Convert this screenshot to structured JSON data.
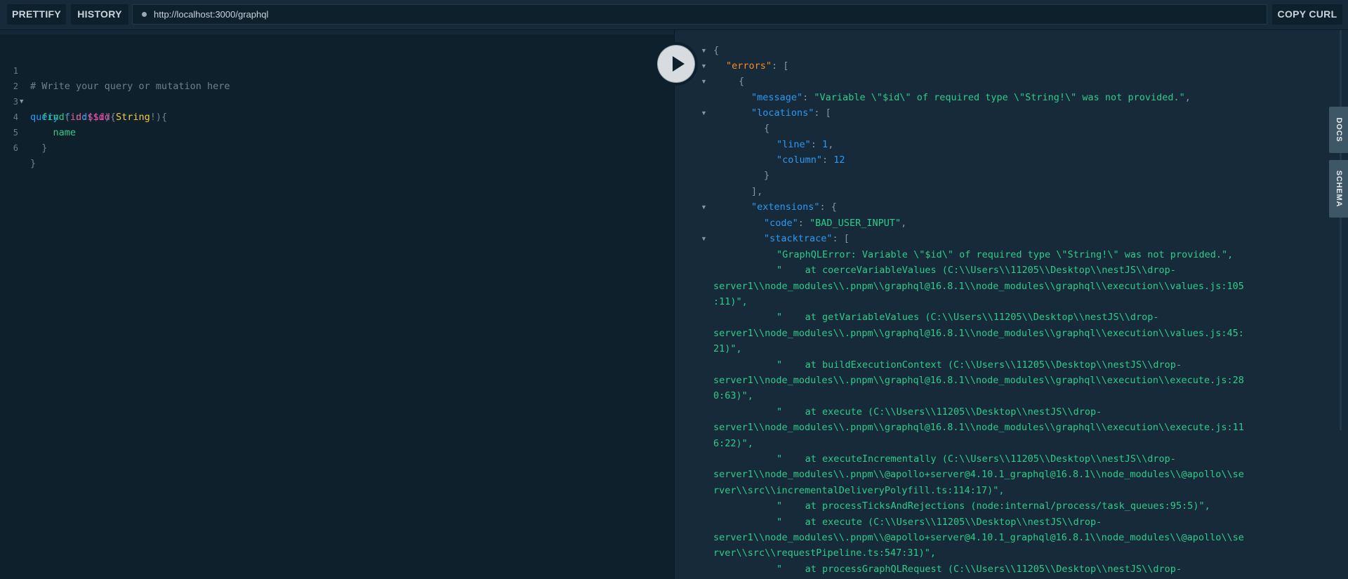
{
  "toolbar": {
    "prettify_label": "PRETTIFY",
    "history_label": "HISTORY",
    "url": "http://localhost:3000/graphql",
    "copy_curl_label": "COPY CURL"
  },
  "side_tabs": {
    "docs": "DOCS",
    "schema": "SCHEMA"
  },
  "icons": {
    "play": "play-icon",
    "fold": "fold-arrow-icon",
    "url_status": "status-dot-icon"
  },
  "colors": {
    "background": "#0f202d",
    "panel": "#172a3a",
    "keyword": "#2b9af3",
    "string": "#2ecc8a",
    "variable": "#e04fa2",
    "type": "#f7c948",
    "error_key": "#f28c28"
  },
  "editor": {
    "line_numbers": [
      "1",
      "2",
      "3",
      "4",
      "5",
      "6"
    ],
    "line1": "# Write your query or mutation here",
    "l2_kw": "query",
    "l2_name": "find",
    "l2_open": "(",
    "l2_var": "$id",
    "l2_colon": ":",
    "l2_type": "String",
    "l2_bang": "!",
    "l2_close": "){",
    "l3_field": "find",
    "l3_open": "(",
    "l3_arg": "id",
    "l3_colon": ":",
    "l3_var": "$id",
    "l3_close": "){",
    "l4_field": "name",
    "l5": "}",
    "l6": "}"
  },
  "result": {
    "open_brace": "{",
    "errors_key": "\"errors\"",
    "colon_bracket": ": [",
    "obj_open": "{",
    "message_key": "\"message\"",
    "message_val": "\"Variable \\\"$id\\\" of required type \\\"String!\\\" was not provided.\"",
    "locations_key": "\"locations\"",
    "loc_open": "{",
    "line_key": "\"line\"",
    "line_val": "1",
    "column_key": "\"column\"",
    "column_val": "12",
    "loc_close": "}",
    "loc_arr_close": "],",
    "extensions_key": "\"extensions\"",
    "colon_brace": ": {",
    "code_key": "\"code\"",
    "code_val": "\"BAD_USER_INPUT\"",
    "stacktrace_key": "\"stacktrace\"",
    "stacktrace": [
      "\"GraphQLError: Variable \\\"$id\\\" of required type \\\"String!\\\" was not provided.\",",
      "\"    at coerceVariableValues (C:\\\\Users\\\\11205\\\\Desktop\\\\nestJS\\\\drop-",
      "server1\\\\node_modules\\\\.pnpm\\\\graphql@16.8.1\\\\node_modules\\\\graphql\\\\execution\\\\values.js:105",
      ":11)\",",
      "\"    at getVariableValues (C:\\\\Users\\\\11205\\\\Desktop\\\\nestJS\\\\drop-",
      "server1\\\\node_modules\\\\.pnpm\\\\graphql@16.8.1\\\\node_modules\\\\graphql\\\\execution\\\\values.js:45:",
      "21)\",",
      "\"    at buildExecutionContext (C:\\\\Users\\\\11205\\\\Desktop\\\\nestJS\\\\drop-",
      "server1\\\\node_modules\\\\.pnpm\\\\graphql@16.8.1\\\\node_modules\\\\graphql\\\\execution\\\\execute.js:28",
      "0:63)\",",
      "\"    at execute (C:\\\\Users\\\\11205\\\\Desktop\\\\nestJS\\\\drop-",
      "server1\\\\node_modules\\\\.pnpm\\\\graphql@16.8.1\\\\node_modules\\\\graphql\\\\execution\\\\execute.js:11",
      "6:22)\",",
      "\"    at executeIncrementally (C:\\\\Users\\\\11205\\\\Desktop\\\\nestJS\\\\drop-",
      "server1\\\\node_modules\\\\.pnpm\\\\@apollo+server@4.10.1_graphql@16.8.1\\\\node_modules\\\\@apollo\\\\se",
      "rver\\\\src\\\\incrementalDeliveryPolyfill.ts:114:17)\",",
      "\"    at processTicksAndRejections (node:internal/process/task_queues:95:5)\",",
      "\"    at execute (C:\\\\Users\\\\11205\\\\Desktop\\\\nestJS\\\\drop-",
      "server1\\\\node_modules\\\\.pnpm\\\\@apollo+server@4.10.1_graphql@16.8.1\\\\node_modules\\\\@apollo\\\\se",
      "rver\\\\src\\\\requestPipeline.ts:547:31)\",",
      "\"    at processGraphQLRequest (C:\\\\Users\\\\11205\\\\Desktop\\\\nestJS\\\\drop-"
    ]
  }
}
